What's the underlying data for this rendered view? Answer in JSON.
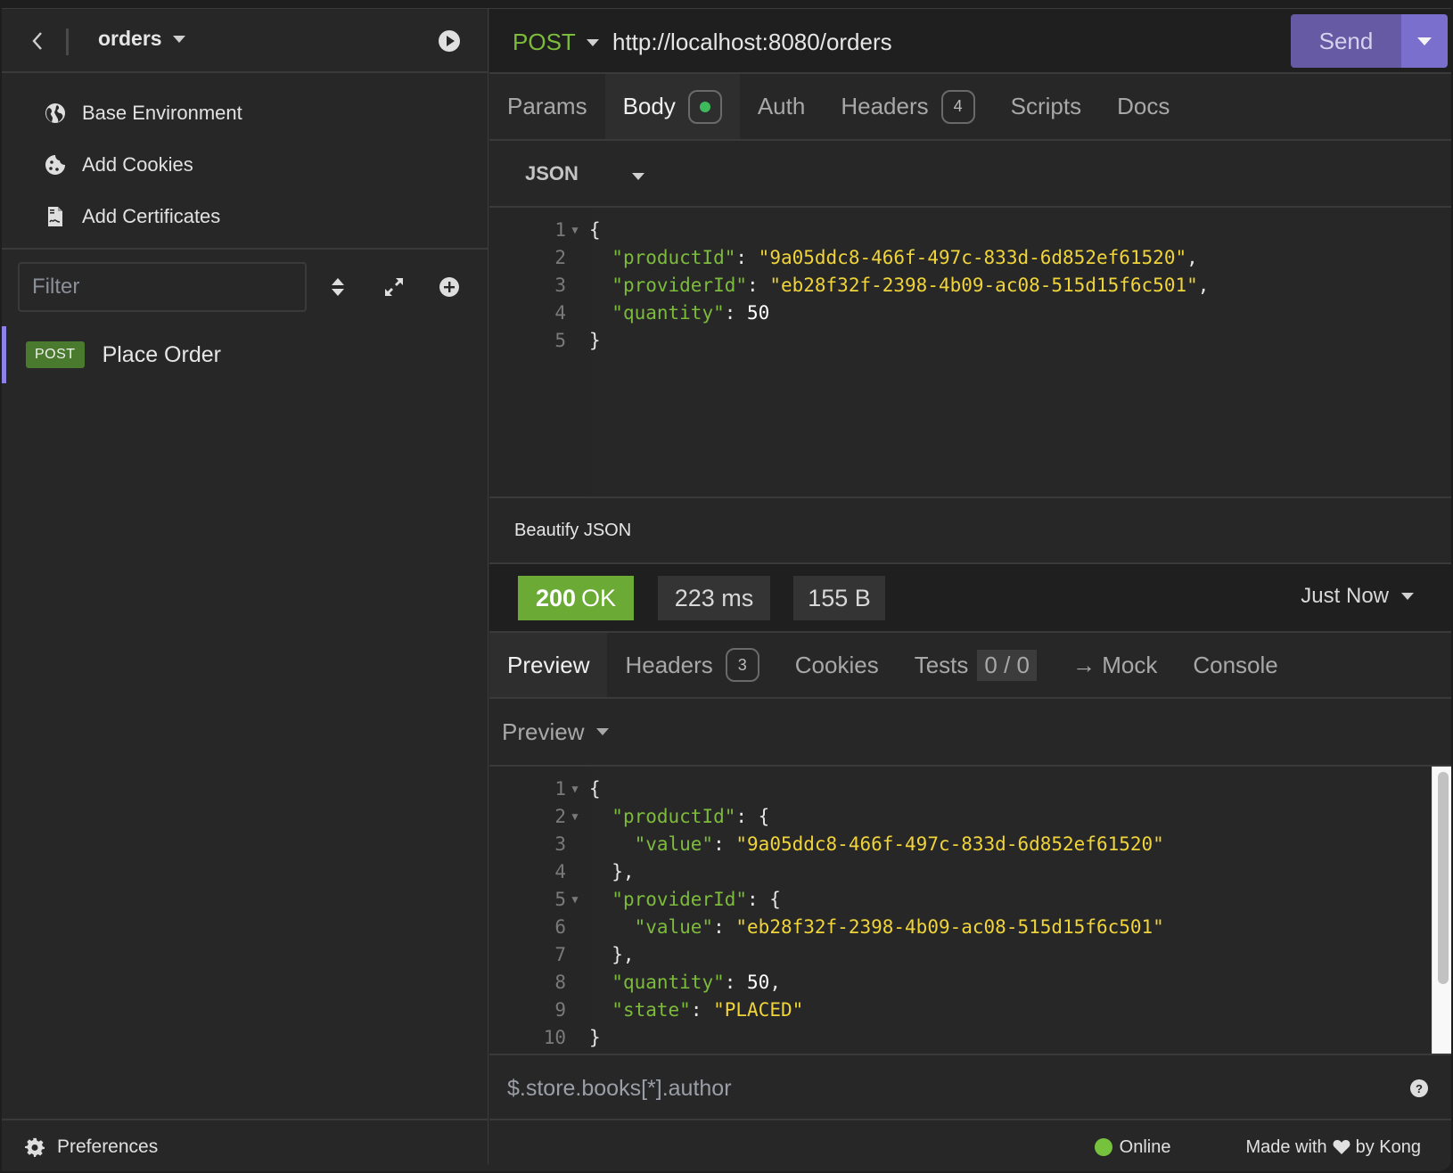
{
  "sidebar": {
    "project_name": "orders",
    "links": [
      {
        "label": "Base Environment",
        "icon": "globe-icon"
      },
      {
        "label": "Add Cookies",
        "icon": "cookie-icon"
      },
      {
        "label": "Add Certificates",
        "icon": "certificate-icon"
      }
    ],
    "filter_placeholder": "Filter",
    "requests": [
      {
        "method": "POST",
        "name": "Place Order"
      }
    ],
    "preferences_label": "Preferences"
  },
  "request": {
    "method": "POST",
    "url": "http://localhost:8080/orders",
    "send_label": "Send",
    "tabs": [
      {
        "label": "Params"
      },
      {
        "label": "Body",
        "indicator": "dot",
        "active": true
      },
      {
        "label": "Auth"
      },
      {
        "label": "Headers",
        "badge": "4"
      },
      {
        "label": "Scripts"
      },
      {
        "label": "Docs"
      }
    ],
    "body_type": "JSON",
    "body_lines": [
      {
        "n": "1",
        "fold": true,
        "parts": [
          [
            "p",
            "{"
          ]
        ]
      },
      {
        "n": "2",
        "parts": [
          [
            "p",
            "  "
          ],
          [
            "k",
            "\"productId\""
          ],
          [
            "p",
            ": "
          ],
          [
            "s",
            "\"9a05ddc8-466f-497c-833d-6d852ef61520\""
          ],
          [
            "p",
            ","
          ]
        ]
      },
      {
        "n": "3",
        "parts": [
          [
            "p",
            "  "
          ],
          [
            "k",
            "\"providerId\""
          ],
          [
            "p",
            ": "
          ],
          [
            "s",
            "\"eb28f32f-2398-4b09-ac08-515d15f6c501\""
          ],
          [
            "p",
            ","
          ]
        ]
      },
      {
        "n": "4",
        "parts": [
          [
            "p",
            "  "
          ],
          [
            "k",
            "\"quantity\""
          ],
          [
            "p",
            ": "
          ],
          [
            "n",
            "50"
          ]
        ]
      },
      {
        "n": "5",
        "parts": [
          [
            "p",
            "}"
          ]
        ]
      }
    ],
    "beautify_label": "Beautify JSON"
  },
  "response": {
    "status_code": "200",
    "status_text": "OK",
    "status_color": "#6aaa35",
    "time": "223 ms",
    "size": "155 B",
    "history_label": "Just Now",
    "tabs": [
      {
        "label": "Preview",
        "active": true
      },
      {
        "label": "Headers",
        "badge": "3"
      },
      {
        "label": "Cookies"
      },
      {
        "label": "Tests",
        "count": "0 / 0"
      },
      {
        "label": "→ Mock"
      },
      {
        "label": "Console"
      }
    ],
    "preview_mode": "Preview",
    "body_lines": [
      {
        "n": "1",
        "fold": true,
        "parts": [
          [
            "p",
            "{"
          ]
        ]
      },
      {
        "n": "2",
        "fold": true,
        "parts": [
          [
            "p",
            "  "
          ],
          [
            "k",
            "\"productId\""
          ],
          [
            "p",
            ": {"
          ]
        ]
      },
      {
        "n": "3",
        "parts": [
          [
            "p",
            "    "
          ],
          [
            "k",
            "\"value\""
          ],
          [
            "p",
            ": "
          ],
          [
            "s",
            "\"9a05ddc8-466f-497c-833d-6d852ef61520\""
          ]
        ]
      },
      {
        "n": "4",
        "parts": [
          [
            "p",
            "  },"
          ]
        ]
      },
      {
        "n": "5",
        "fold": true,
        "parts": [
          [
            "p",
            "  "
          ],
          [
            "k",
            "\"providerId\""
          ],
          [
            "p",
            ": {"
          ]
        ]
      },
      {
        "n": "6",
        "parts": [
          [
            "p",
            "    "
          ],
          [
            "k",
            "\"value\""
          ],
          [
            "p",
            ": "
          ],
          [
            "s",
            "\"eb28f32f-2398-4b09-ac08-515d15f6c501\""
          ]
        ]
      },
      {
        "n": "7",
        "parts": [
          [
            "p",
            "  },"
          ]
        ]
      },
      {
        "n": "8",
        "parts": [
          [
            "p",
            "  "
          ],
          [
            "k",
            "\"quantity\""
          ],
          [
            "p",
            ": "
          ],
          [
            "n",
            "50"
          ],
          [
            "p",
            ","
          ]
        ]
      },
      {
        "n": "9",
        "parts": [
          [
            "p",
            "  "
          ],
          [
            "k",
            "\"state\""
          ],
          [
            "p",
            ": "
          ],
          [
            "s",
            "\"PLACED\""
          ]
        ]
      },
      {
        "n": "10",
        "parts": [
          [
            "p",
            "}"
          ]
        ]
      }
    ],
    "jsonpath_placeholder": "$.store.books[*].author"
  },
  "footer": {
    "online_label": "Online",
    "made_with_prefix": "Made with",
    "made_with_suffix": "by Kong"
  },
  "colors": {
    "accent": "#7b6fcd",
    "send": "#655aa3",
    "method_post": "#7dbb3c",
    "json_key": "#7dbb3c",
    "json_string": "#f0d43a",
    "online": "#77c23c"
  }
}
